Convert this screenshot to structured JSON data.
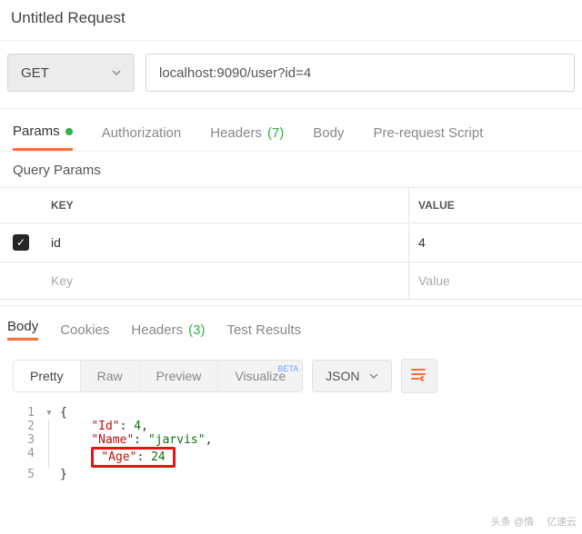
{
  "title": "Untitled Request",
  "method": "GET",
  "url": "localhost:9090/user?id=4",
  "request_tabs": {
    "params": "Params",
    "authorization": "Authorization",
    "headers": "Headers",
    "headers_count": "(7)",
    "body": "Body",
    "prerequest": "Pre-request Script"
  },
  "query_params": {
    "title": "Query Params",
    "head_key": "KEY",
    "head_value": "VALUE",
    "rows": [
      {
        "checked": true,
        "key": "id",
        "value": "4"
      }
    ],
    "placeholder_key": "Key",
    "placeholder_value": "Value"
  },
  "response_tabs": {
    "body": "Body",
    "cookies": "Cookies",
    "headers": "Headers",
    "headers_count": "(3)",
    "test_results": "Test Results"
  },
  "view_modes": {
    "pretty": "Pretty",
    "raw": "Raw",
    "preview": "Preview",
    "visualize": "Visualize",
    "beta": "BETA"
  },
  "format": "JSON",
  "response_body": {
    "Id": 4,
    "Name": "jarvis",
    "Age": 24
  },
  "code_lines": {
    "l1": "{",
    "l2_k": "\"Id\"",
    "l2_v": "4",
    "l3_k": "\"Name\"",
    "l3_v": "\"jarvis\"",
    "l4_k": "\"Age\"",
    "l4_v": "24",
    "l5": "}"
  },
  "watermark": {
    "left": "头条 @惰",
    "right": "亿速云"
  }
}
